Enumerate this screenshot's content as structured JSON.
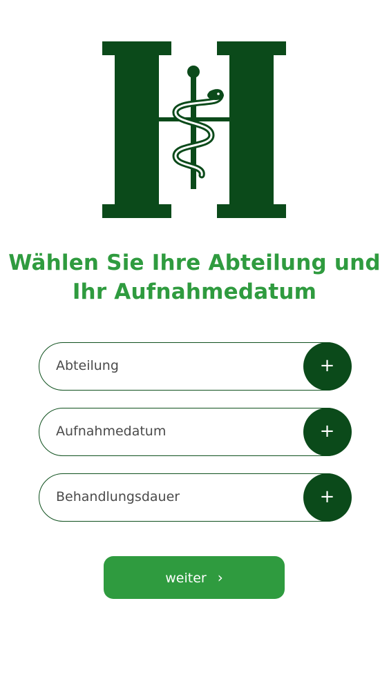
{
  "logo": {
    "icon": "hospital-h-aesculapius-logo-icon",
    "color": "#0b4a1a"
  },
  "headline": {
    "line1": "Wählen Sie Ihre Abteilung und",
    "line2": "Ihr Aufnahmedatum"
  },
  "fields": [
    {
      "label": "Abteilung",
      "button": "+"
    },
    {
      "label": "Aufnahmedatum",
      "button": "+"
    },
    {
      "label": "Behandlungsdauer",
      "button": "+"
    }
  ],
  "next_button": {
    "label": "weiter",
    "icon": "chevron-right-icon",
    "chevron": "›"
  },
  "colors": {
    "accent_green": "#2f9b3f",
    "dark_green": "#0b4a1a",
    "background": "#ffffff"
  }
}
